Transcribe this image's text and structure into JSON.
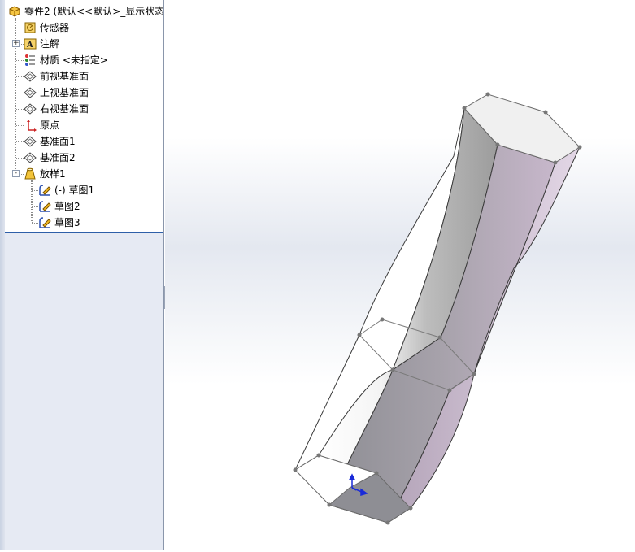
{
  "tree": {
    "root": {
      "label": "零件2  (默认<<默认>_显示状态",
      "icon": "part-icon"
    },
    "items": [
      {
        "label": "传感器",
        "icon": "sensor-icon",
        "expander": ""
      },
      {
        "label": "注解",
        "icon": "annotation-icon",
        "expander": "+"
      },
      {
        "label": "材质 <未指定>",
        "icon": "material-icon",
        "expander": ""
      },
      {
        "label": "前视基准面",
        "icon": "plane-icon",
        "expander": ""
      },
      {
        "label": "上视基准面",
        "icon": "plane-icon",
        "expander": ""
      },
      {
        "label": "右视基准面",
        "icon": "plane-icon",
        "expander": ""
      },
      {
        "label": "原点",
        "icon": "origin-icon",
        "expander": ""
      },
      {
        "label": "基准面1",
        "icon": "plane-icon",
        "expander": ""
      },
      {
        "label": "基准面2",
        "icon": "plane-icon",
        "expander": ""
      },
      {
        "label": "放样1",
        "icon": "loft-icon",
        "expander": "-"
      }
    ],
    "children": [
      {
        "label": "(-) 草图1",
        "icon": "sketch-icon"
      },
      {
        "label": "草图2",
        "icon": "sketch-icon"
      },
      {
        "label": "草图3",
        "icon": "sketch-icon"
      }
    ]
  },
  "colors": {
    "panel_bg": "#e6eaf3",
    "separator": "#2e5fa8",
    "model_face_dark": "#8f8f95",
    "model_face_light": "#ffffff",
    "model_face_purple": "#c8b8cc",
    "edge": "#3a3a3a",
    "triad_blue": "#1a2bd8"
  }
}
